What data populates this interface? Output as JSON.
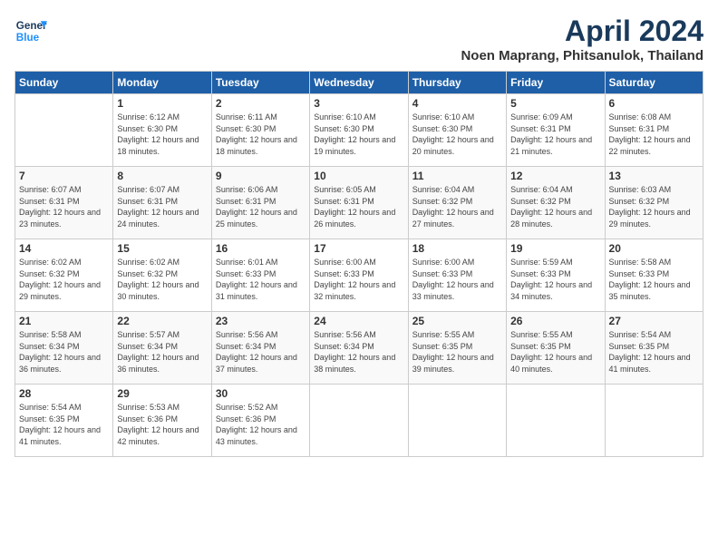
{
  "header": {
    "logo_line1": "General",
    "logo_line2": "Blue",
    "month": "April 2024",
    "location": "Noen Maprang, Phitsanulok, Thailand"
  },
  "weekdays": [
    "Sunday",
    "Monday",
    "Tuesday",
    "Wednesday",
    "Thursday",
    "Friday",
    "Saturday"
  ],
  "weeks": [
    [
      {
        "day": "",
        "sunrise": "",
        "sunset": "",
        "daylight": ""
      },
      {
        "day": "1",
        "sunrise": "Sunrise: 6:12 AM",
        "sunset": "Sunset: 6:30 PM",
        "daylight": "Daylight: 12 hours and 18 minutes."
      },
      {
        "day": "2",
        "sunrise": "Sunrise: 6:11 AM",
        "sunset": "Sunset: 6:30 PM",
        "daylight": "Daylight: 12 hours and 18 minutes."
      },
      {
        "day": "3",
        "sunrise": "Sunrise: 6:10 AM",
        "sunset": "Sunset: 6:30 PM",
        "daylight": "Daylight: 12 hours and 19 minutes."
      },
      {
        "day": "4",
        "sunrise": "Sunrise: 6:10 AM",
        "sunset": "Sunset: 6:30 PM",
        "daylight": "Daylight: 12 hours and 20 minutes."
      },
      {
        "day": "5",
        "sunrise": "Sunrise: 6:09 AM",
        "sunset": "Sunset: 6:31 PM",
        "daylight": "Daylight: 12 hours and 21 minutes."
      },
      {
        "day": "6",
        "sunrise": "Sunrise: 6:08 AM",
        "sunset": "Sunset: 6:31 PM",
        "daylight": "Daylight: 12 hours and 22 minutes."
      }
    ],
    [
      {
        "day": "7",
        "sunrise": "Sunrise: 6:07 AM",
        "sunset": "Sunset: 6:31 PM",
        "daylight": "Daylight: 12 hours and 23 minutes."
      },
      {
        "day": "8",
        "sunrise": "Sunrise: 6:07 AM",
        "sunset": "Sunset: 6:31 PM",
        "daylight": "Daylight: 12 hours and 24 minutes."
      },
      {
        "day": "9",
        "sunrise": "Sunrise: 6:06 AM",
        "sunset": "Sunset: 6:31 PM",
        "daylight": "Daylight: 12 hours and 25 minutes."
      },
      {
        "day": "10",
        "sunrise": "Sunrise: 6:05 AM",
        "sunset": "Sunset: 6:31 PM",
        "daylight": "Daylight: 12 hours and 26 minutes."
      },
      {
        "day": "11",
        "sunrise": "Sunrise: 6:04 AM",
        "sunset": "Sunset: 6:32 PM",
        "daylight": "Daylight: 12 hours and 27 minutes."
      },
      {
        "day": "12",
        "sunrise": "Sunrise: 6:04 AM",
        "sunset": "Sunset: 6:32 PM",
        "daylight": "Daylight: 12 hours and 28 minutes."
      },
      {
        "day": "13",
        "sunrise": "Sunrise: 6:03 AM",
        "sunset": "Sunset: 6:32 PM",
        "daylight": "Daylight: 12 hours and 29 minutes."
      }
    ],
    [
      {
        "day": "14",
        "sunrise": "Sunrise: 6:02 AM",
        "sunset": "Sunset: 6:32 PM",
        "daylight": "Daylight: 12 hours and 29 minutes."
      },
      {
        "day": "15",
        "sunrise": "Sunrise: 6:02 AM",
        "sunset": "Sunset: 6:32 PM",
        "daylight": "Daylight: 12 hours and 30 minutes."
      },
      {
        "day": "16",
        "sunrise": "Sunrise: 6:01 AM",
        "sunset": "Sunset: 6:33 PM",
        "daylight": "Daylight: 12 hours and 31 minutes."
      },
      {
        "day": "17",
        "sunrise": "Sunrise: 6:00 AM",
        "sunset": "Sunset: 6:33 PM",
        "daylight": "Daylight: 12 hours and 32 minutes."
      },
      {
        "day": "18",
        "sunrise": "Sunrise: 6:00 AM",
        "sunset": "Sunset: 6:33 PM",
        "daylight": "Daylight: 12 hours and 33 minutes."
      },
      {
        "day": "19",
        "sunrise": "Sunrise: 5:59 AM",
        "sunset": "Sunset: 6:33 PM",
        "daylight": "Daylight: 12 hours and 34 minutes."
      },
      {
        "day": "20",
        "sunrise": "Sunrise: 5:58 AM",
        "sunset": "Sunset: 6:33 PM",
        "daylight": "Daylight: 12 hours and 35 minutes."
      }
    ],
    [
      {
        "day": "21",
        "sunrise": "Sunrise: 5:58 AM",
        "sunset": "Sunset: 6:34 PM",
        "daylight": "Daylight: 12 hours and 36 minutes."
      },
      {
        "day": "22",
        "sunrise": "Sunrise: 5:57 AM",
        "sunset": "Sunset: 6:34 PM",
        "daylight": "Daylight: 12 hours and 36 minutes."
      },
      {
        "day": "23",
        "sunrise": "Sunrise: 5:56 AM",
        "sunset": "Sunset: 6:34 PM",
        "daylight": "Daylight: 12 hours and 37 minutes."
      },
      {
        "day": "24",
        "sunrise": "Sunrise: 5:56 AM",
        "sunset": "Sunset: 6:34 PM",
        "daylight": "Daylight: 12 hours and 38 minutes."
      },
      {
        "day": "25",
        "sunrise": "Sunrise: 5:55 AM",
        "sunset": "Sunset: 6:35 PM",
        "daylight": "Daylight: 12 hours and 39 minutes."
      },
      {
        "day": "26",
        "sunrise": "Sunrise: 5:55 AM",
        "sunset": "Sunset: 6:35 PM",
        "daylight": "Daylight: 12 hours and 40 minutes."
      },
      {
        "day": "27",
        "sunrise": "Sunrise: 5:54 AM",
        "sunset": "Sunset: 6:35 PM",
        "daylight": "Daylight: 12 hours and 41 minutes."
      }
    ],
    [
      {
        "day": "28",
        "sunrise": "Sunrise: 5:54 AM",
        "sunset": "Sunset: 6:35 PM",
        "daylight": "Daylight: 12 hours and 41 minutes."
      },
      {
        "day": "29",
        "sunrise": "Sunrise: 5:53 AM",
        "sunset": "Sunset: 6:36 PM",
        "daylight": "Daylight: 12 hours and 42 minutes."
      },
      {
        "day": "30",
        "sunrise": "Sunrise: 5:52 AM",
        "sunset": "Sunset: 6:36 PM",
        "daylight": "Daylight: 12 hours and 43 minutes."
      },
      {
        "day": "",
        "sunrise": "",
        "sunset": "",
        "daylight": ""
      },
      {
        "day": "",
        "sunrise": "",
        "sunset": "",
        "daylight": ""
      },
      {
        "day": "",
        "sunrise": "",
        "sunset": "",
        "daylight": ""
      },
      {
        "day": "",
        "sunrise": "",
        "sunset": "",
        "daylight": ""
      }
    ]
  ]
}
